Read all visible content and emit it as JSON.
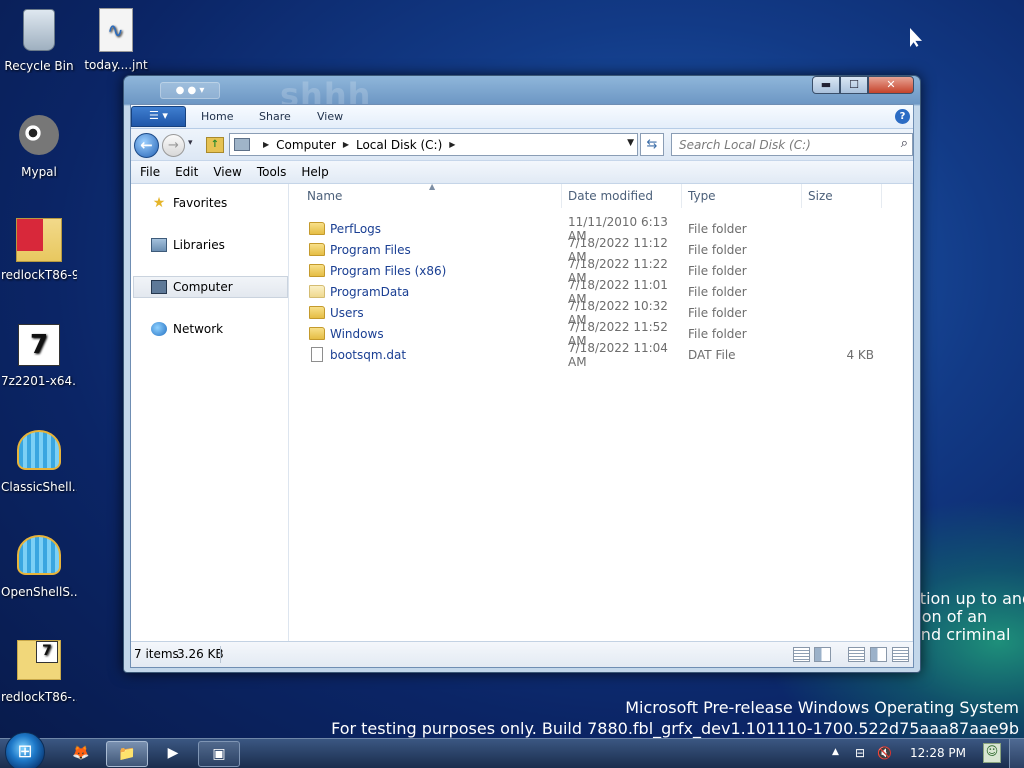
{
  "desktop": {
    "icons": [
      {
        "label": "Recycle Bin",
        "icon": "recycle-bin-icon"
      },
      {
        "label": "today....jnt",
        "icon": "journal-file-icon"
      },
      {
        "label": "Mypal",
        "icon": "mypal-browser-icon"
      },
      {
        "label": "redlockT86-9",
        "icon": "redlock-archive-icon"
      },
      {
        "label": "7z2201-x64....",
        "icon": "7zip-installer-icon"
      },
      {
        "label": "ClassicShell...",
        "icon": "classic-shell-icon"
      },
      {
        "label": "OpenShellS...",
        "icon": "open-shell-icon"
      },
      {
        "label": "redlockT86-...",
        "icon": "redlock-folder-icon"
      }
    ],
    "background_text": [
      "ction up to and",
      "tion of an",
      "and criminal"
    ],
    "watermark": {
      "line1": "Microsoft Pre-release Windows Operating System",
      "line2": "For testing purposes only. Build 7880.fbl_grfx_dev1.101110-1700.522d75aaa87aae9b"
    }
  },
  "window": {
    "title_watermark": "shhh",
    "qat_label": "●  ●  ▾",
    "caption": {
      "minimize": "▬",
      "maximize": "☐",
      "close": "✕"
    },
    "ribbon": {
      "file_tab": "☰ ▾",
      "tabs": [
        "Home",
        "Share",
        "View"
      ],
      "help": "?"
    },
    "nav": {
      "back": "←",
      "forward": "→",
      "history": "▾",
      "up": "↑"
    },
    "address": {
      "crumbs": [
        "Computer",
        "Local Disk (C:)"
      ],
      "separator": "▶",
      "dropdown": "▼",
      "refresh": "⇆"
    },
    "search": {
      "placeholder": "Search Local Disk (C:)",
      "value": ""
    },
    "menu": [
      "File",
      "Edit",
      "View",
      "Tools",
      "Help"
    ],
    "nav_pane": [
      {
        "label": "Favorites",
        "icon": "star-icon",
        "selected": false
      },
      {
        "label": "Libraries",
        "icon": "libraries-icon",
        "selected": false
      },
      {
        "label": "Computer",
        "icon": "computer-icon",
        "selected": true
      },
      {
        "label": "Network",
        "icon": "network-icon",
        "selected": false
      }
    ],
    "columns": [
      "Name",
      "Date modified",
      "Type",
      "Size"
    ],
    "sort_indicator": "▲",
    "files": [
      {
        "name": "PerfLogs",
        "date": "11/11/2010 6:13 AM",
        "type": "File folder",
        "size": "",
        "kind": "folder"
      },
      {
        "name": "Program Files",
        "date": "7/18/2022 11:12 AM",
        "type": "File folder",
        "size": "",
        "kind": "folder"
      },
      {
        "name": "Program Files (x86)",
        "date": "7/18/2022 11:22 AM",
        "type": "File folder",
        "size": "",
        "kind": "folder"
      },
      {
        "name": "ProgramData",
        "date": "7/18/2022 11:01 AM",
        "type": "File folder",
        "size": "",
        "kind": "folder-hidden"
      },
      {
        "name": "Users",
        "date": "7/18/2022 10:32 AM",
        "type": "File folder",
        "size": "",
        "kind": "folder"
      },
      {
        "name": "Windows",
        "date": "7/18/2022 11:52 AM",
        "type": "File folder",
        "size": "",
        "kind": "folder"
      },
      {
        "name": "bootsqm.dat",
        "date": "7/18/2022 11:04 AM",
        "type": "DAT File",
        "size": "4 KB",
        "kind": "file"
      }
    ],
    "status": {
      "items": "7 items",
      "size": "3.26 KB"
    }
  },
  "taskbar": {
    "start": "⊞",
    "buttons": [
      {
        "icon": "fox-icon",
        "glyph": "🦊",
        "state": "normal"
      },
      {
        "icon": "explorer-icon",
        "glyph": "📁",
        "state": "active"
      },
      {
        "icon": "media-player-icon",
        "glyph": "▶",
        "state": "normal"
      },
      {
        "icon": "app-window-icon",
        "glyph": "▣",
        "state": "running"
      }
    ],
    "tray": {
      "arrow": "▲",
      "network": "⊟",
      "volume": "🔇",
      "clock": "12:28 PM",
      "person": "☺"
    }
  }
}
